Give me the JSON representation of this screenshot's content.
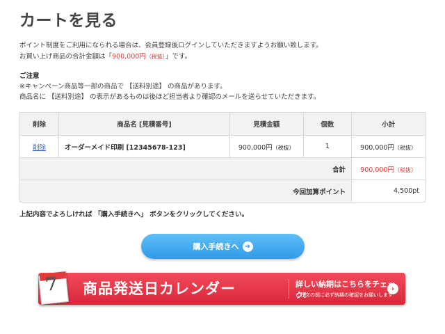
{
  "page_title": "カートを見る",
  "intro": {
    "line1": "ポイント制度をご利用になられる場合は、会員登録後ログインしていただきますようお願い致します。",
    "line2_pre": "お買い上げ商品の合計金額は「",
    "line2_amount": "900,000円",
    "line2_tax": "（税抜）",
    "line2_post": "」です。"
  },
  "notice": {
    "heading": "ご注意",
    "line1": "※キャンペーン商品等一部の商品で 【送料別途】 の商品があります。",
    "line2": "商品名に 【送料別途】 の表示があるものは後ほど担当者より確認のメールを送らせていただきます。"
  },
  "table": {
    "headers": {
      "delete": "削除",
      "name": "商品名 [見積番号]",
      "price": "見積金額",
      "qty": "個数",
      "subtotal": "小計"
    },
    "rows": [
      {
        "delete_label": "削除",
        "name": "オーダーメイド印刷 [12345678-123]",
        "price": "900,000円",
        "price_tax": "（税抜）",
        "qty": "1",
        "subtotal": "900,000円",
        "subtotal_tax": "（税抜）"
      }
    ],
    "total_label": "合計",
    "total_value": "900,000円",
    "total_tax": "（税抜）",
    "points_label": "今回加算ポイント",
    "points_value": "4,500pt"
  },
  "confirm_text": "上記内容でよろしければ 「購入手続きへ」 ボタンをクリックしてください。",
  "checkout_button": {
    "label": "購入手続きへ",
    "icon": "arrow-right-circle-icon"
  },
  "banner": {
    "calendar_day": "7",
    "title": "商品発送日カレンダー",
    "sub_title": "詳しい納期はこちらをチェック!",
    "sub_note": "ご注文の前に必ず納期の確認をお願いします",
    "accent_color": "#e03a3a"
  },
  "colors": {
    "link": "#3366cc",
    "price_red": "#e03a3a",
    "button_blue": "#2f9be8",
    "banner_red": "#d8283a"
  }
}
